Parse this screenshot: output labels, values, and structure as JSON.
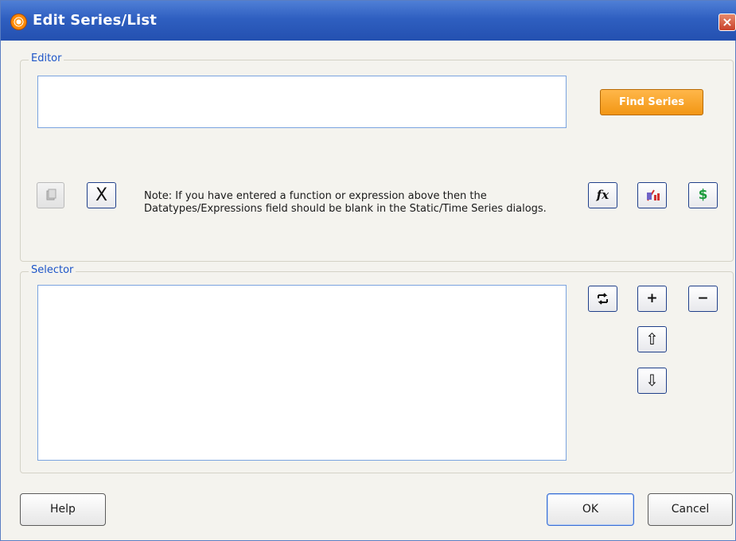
{
  "window": {
    "title": "Edit Series/List",
    "close_label": "×"
  },
  "editor": {
    "group_label": "Editor",
    "find_series_label": "Find Series",
    "note": "Note: If you have entered a function or expression above then the Datatypes/Expressions field should be blank in the Static/Time Series dialogs.",
    "icons": [
      "copy-icon",
      "clear-x-icon",
      "function-fx-icon",
      "datatype-icon",
      "currency-icon"
    ],
    "clear_glyph": "X",
    "fx_glyph": "fx",
    "currency_glyph": "$"
  },
  "selector": {
    "group_label": "Selector",
    "icons": [
      "refresh-icon",
      "add-icon",
      "remove-icon",
      "move-up-icon",
      "move-down-icon"
    ],
    "add_glyph": "+",
    "remove_glyph": "−",
    "up_glyph": "⇧",
    "down_glyph": "⇩"
  },
  "footer": {
    "help_label": "Help",
    "ok_label": "OK",
    "cancel_label": "Cancel"
  },
  "colors": {
    "titlebar": "#2f5fc0",
    "group_label": "#1d55c8",
    "find_series": "#f29614",
    "currency_green": "#1a9a3a"
  }
}
